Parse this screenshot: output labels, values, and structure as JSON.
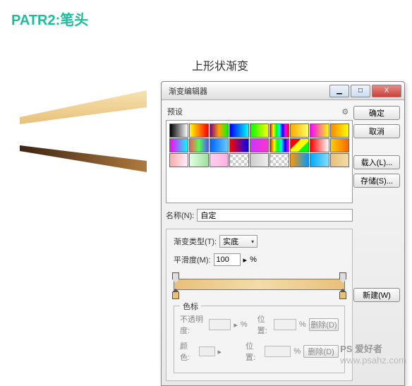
{
  "header": "PATR2:笔头",
  "subtitle": "上形状渐变",
  "shapes": {
    "top_gradient": [
      "#f6e3b0",
      "#e8c07a"
    ],
    "bottom_gradient": [
      "#3d2412",
      "#b07a3e"
    ]
  },
  "dialog": {
    "title": "渐变编辑器",
    "win": {
      "min": "▁",
      "max": "□",
      "close": "X"
    },
    "presets_label": "预设",
    "gear_icon": "⚙",
    "buttons": {
      "ok": "确定",
      "cancel": "取消",
      "load": "载入(L)...",
      "save": "存储(S)...",
      "new": "新建(W)"
    },
    "name_label": "名称(N):",
    "name_value": "自定",
    "type_label": "渐变类型(T):",
    "type_value": "实底",
    "smooth_label": "平滑度(M):",
    "smooth_value": "100",
    "percent": "%",
    "swatches": [
      "linear-gradient(90deg,#000,#fff)",
      "linear-gradient(90deg,#ff0,#f00)",
      "linear-gradient(90deg,#800080,#ffa500,#0f0)",
      "linear-gradient(90deg,#00f,#0ff)",
      "linear-gradient(90deg,#0f0,#ff0)",
      "linear-gradient(90deg,#f00,#ff0,#0f0,#0ff,#00f,#f0f,#f00)",
      "linear-gradient(90deg,#fa0,#ff6)",
      "linear-gradient(90deg,#f0f,#ff0)",
      "linear-gradient(90deg,#f80,#ff0)",
      "linear-gradient(90deg,#f0f,#0ff)",
      "linear-gradient(90deg,#f55,#5f5,#55f)",
      "linear-gradient(90deg,#06f,#6cf)",
      "linear-gradient(90deg,#f00,#00f)",
      "linear-gradient(90deg,#c3f,#f3c)",
      "linear-gradient(90deg,#f00,#ff0,#0f0,#0ff,#00f,#f0f)",
      "linear-gradient(135deg,#f00 33%,#ff0 33% 66%,#0f0 66%)",
      "linear-gradient(90deg,#f00,#fff)",
      "linear-gradient(90deg,#fc0,#f60)",
      "linear-gradient(90deg,#faa,#fef)",
      "linear-gradient(90deg,#dfffe0,#a0e0a0)",
      "linear-gradient(90deg,#ffd0f0,#ffb0e0)",
      "repeating-conic-gradient(#ccc 0 25%,#fff 0 50%) 0/8px 8px",
      "linear-gradient(90deg,#ccc,#eee)",
      "repeating-conic-gradient(#ccc 0 25%,#fff 0 50%) 0/8px 8px",
      "linear-gradient(90deg,#f90,#09f)",
      "linear-gradient(90deg,#0af,#8df)",
      "linear-gradient(90deg,#e8c07a,#f3dca8)"
    ],
    "stops_group": {
      "legend": "色标",
      "opacity_label": "不透明度:",
      "position_label": "位置:",
      "delete_label": "删除(D)",
      "color_label": "颜色:"
    }
  },
  "watermark": {
    "brand": "PS 爱好者",
    "url": "www.psahz.com"
  }
}
